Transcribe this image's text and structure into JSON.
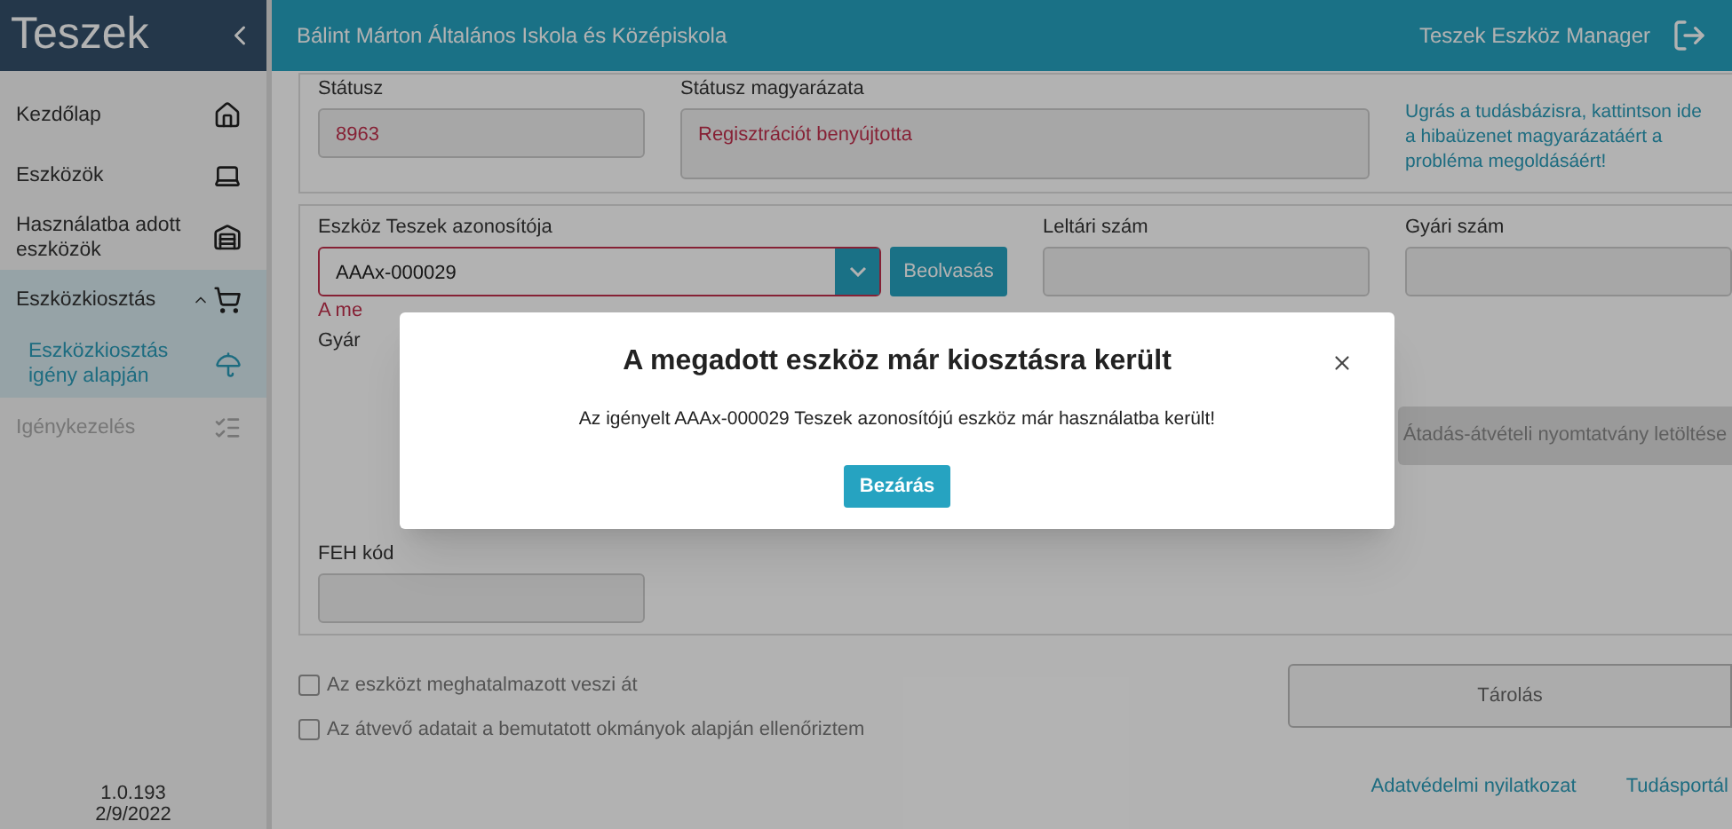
{
  "sidebar": {
    "brand": "Teszek",
    "items": [
      {
        "label": "Kezdőlap",
        "selected": false,
        "disabled": false
      },
      {
        "label": "Eszközök",
        "selected": false,
        "disabled": false
      },
      {
        "label": "Használatba adott eszközök",
        "selected": false,
        "disabled": false
      },
      {
        "label": "Eszközkiosztás",
        "selected": true,
        "disabled": false,
        "expanded": true,
        "children": [
          {
            "label": "Eszközkiosztás igény alapján",
            "selected": true
          }
        ]
      },
      {
        "label": "Igénykezelés",
        "selected": false,
        "disabled": true
      }
    ],
    "version": "1.0.193",
    "date": "2/9/2022"
  },
  "header": {
    "title": "Bálint Márton Általános Iskola és Középiskola",
    "app_name": "Teszek Eszköz Manager"
  },
  "status_card": {
    "fields": [
      {
        "label": "Státusz",
        "value": "8963"
      },
      {
        "label": "Státusz magyarázata",
        "value": "Regisztrációt benyújtotta"
      }
    ],
    "help_link": "Ugrás a tudásbázisra, kattintson ide a hibaüzenet magyarázatáért a probléma megoldásáért!"
  },
  "device_card": {
    "id_field": {
      "label": "Eszköz Teszek azonosítója",
      "value": "AAAx-000029",
      "error": true
    },
    "scan_button": "Beolvasás",
    "inventory_field": {
      "label": "Leltári szám"
    },
    "serial_field": {
      "label": "Gyári szám"
    },
    "error_text": "A me",
    "second_label": "Gyár",
    "download_button": {
      "label": "Átadás-átvételi nyomtatvány letöltése",
      "disabled": true
    },
    "feh_field": {
      "label": "FEH kód"
    }
  },
  "checkboxes": [
    {
      "label": "Az eszközt meghatalmazott veszi át",
      "checked": false
    },
    {
      "label": "Az átvevő adatait a bemutatott okmányok alapján ellenőriztem",
      "checked": false
    }
  ],
  "save_button": "Tárolás",
  "footer_links": [
    "Adatvédelmi nyilatkozat",
    "Tudásportál"
  ],
  "modal": {
    "title": "A megadott eszköz már kiosztásra került",
    "message": "Az igényelt AAAx-000029 Teszek azonosítójú eszköz már használatba került!",
    "button": "Bezárás"
  }
}
